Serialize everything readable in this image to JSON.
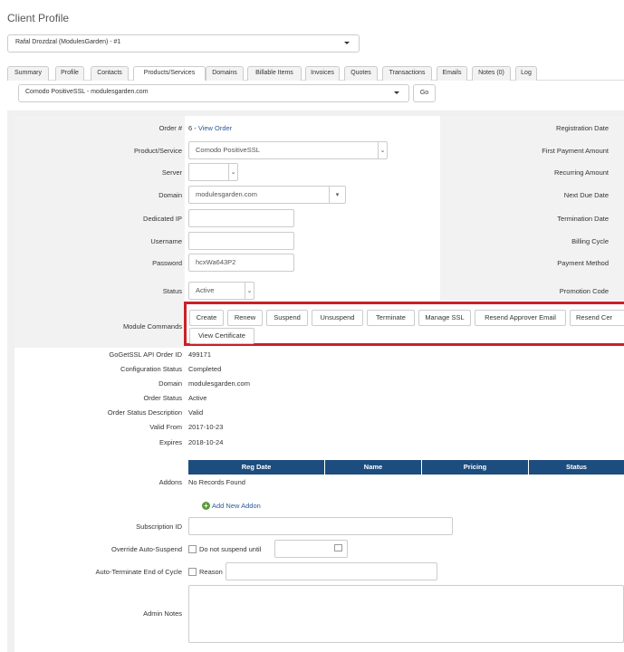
{
  "page_title": "Client Profile",
  "client_select": "Rafal Drozdzal (ModulesGarden) - #1",
  "tabs": [
    "Summary",
    "Profile",
    "Contacts",
    "Products/Services",
    "Domains",
    "Billable Items",
    "Invoices",
    "Quotes",
    "Transactions",
    "Emails",
    "Notes (0)",
    "Log"
  ],
  "active_tab": "Products/Services",
  "service_select": "Comodo PositiveSSL - modulesgarden.com",
  "go_label": "Go",
  "fields": {
    "order_label": "Order #",
    "order_value": "6 - ",
    "order_link": "View Order",
    "product_label": "Product/Service",
    "product_value": "Comodo PositiveSSL",
    "server_label": "Server",
    "domain_label": "Domain",
    "domain_value": "modulesgarden.com",
    "dedicated_ip_label": "Dedicated IP",
    "username_label": "Username",
    "password_label": "Password",
    "password_value": "hcxWa643P2",
    "status_label": "Status",
    "status_value": "Active",
    "module_commands_label": "Module Commands"
  },
  "right_labels": [
    "Registration Date",
    "First Payment Amount",
    "Recurring Amount",
    "Next Due Date",
    "Termination Date",
    "Billing Cycle",
    "Payment Method",
    "Promotion Code"
  ],
  "module_buttons": [
    "Create",
    "Renew",
    "Suspend",
    "Unsuspend",
    "Terminate",
    "Manage SSL",
    "Resend Approver Email",
    "Resend Cer"
  ],
  "view_certificate": "View Certificate",
  "info": [
    {
      "label": "GoGetSSL API Order ID",
      "value": "499171"
    },
    {
      "label": "Configuration Status",
      "value": "Completed"
    },
    {
      "label": "Domain",
      "value": "modulesgarden.com"
    },
    {
      "label": "Order Status",
      "value": "Active"
    },
    {
      "label": "Order Status Description",
      "value": "Valid"
    },
    {
      "label": "Valid From",
      "value": "2017-10-23"
    },
    {
      "label": "Expires",
      "value": "2018-10-24"
    }
  ],
  "addons": {
    "label": "Addons",
    "columns": [
      "Reg Date",
      "Name",
      "Pricing",
      "Status"
    ],
    "empty": "No Records Found",
    "add_label": "Add New Addon"
  },
  "subscription_label": "Subscription ID",
  "override_label": "Override Auto-Suspend",
  "override_text": "Do not suspend until",
  "autoterm_label": "Auto-Terminate End of Cycle",
  "autoterm_text": "Reason",
  "admin_notes_label": "Admin Notes",
  "colors": {
    "accent": "#1d4d7f",
    "highlight": "#cc1f27",
    "link": "#2a5a9c"
  }
}
